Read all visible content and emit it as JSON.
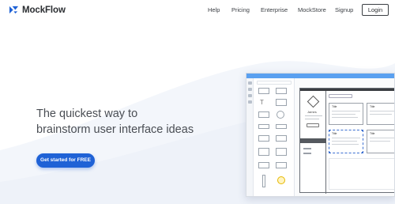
{
  "brand": {
    "name": "MockFlow",
    "color": "#1f62d6"
  },
  "nav": {
    "help": "Help",
    "pricing": "Pricing",
    "enterprise": "Enterprise",
    "mockstore": "MockStore",
    "signup": "Signup",
    "login": "Login"
  },
  "hero": {
    "line1": "The quickest way to",
    "line2": "brainstorm user interface ideas",
    "cta": "Get started for FREE"
  },
  "mockup": {
    "profile_name": "James",
    "card_title": "Title"
  },
  "colors": {
    "accent": "#1f62d6",
    "text": "#4a4e54",
    "mock_topbar": "#5aa0f0"
  }
}
